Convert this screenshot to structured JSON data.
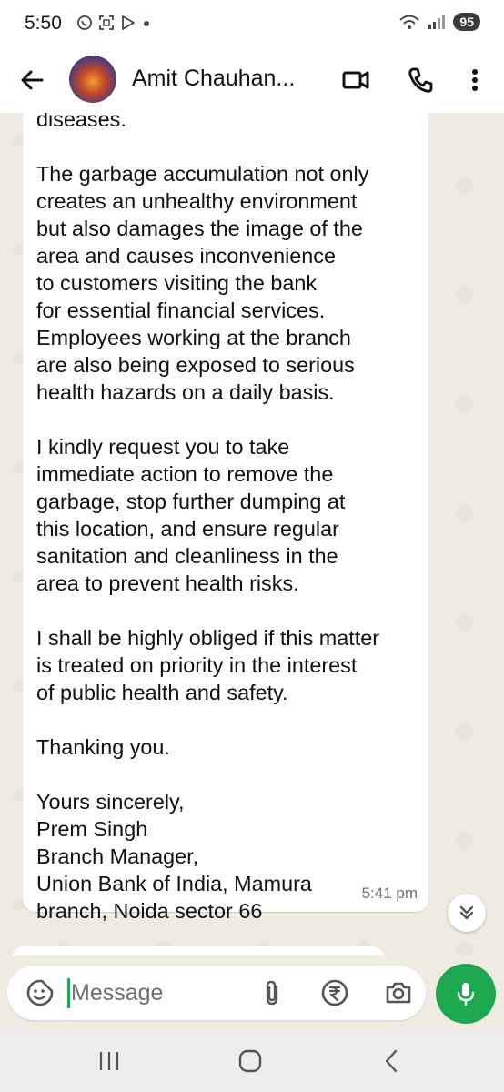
{
  "status_bar": {
    "time": "5:50",
    "battery": "95",
    "icons": [
      "whatsapp-icon",
      "screenshot-icon",
      "play-store-icon",
      "dot-icon",
      "wifi-icon",
      "signal-icon"
    ]
  },
  "header": {
    "contact_name": "Amit Chauhan...",
    "icons": [
      "back-arrow-icon",
      "video-call-icon",
      "voice-call-icon",
      "more-options-icon"
    ]
  },
  "message": {
    "lines_partial_top": "diseases.",
    "paragraphs": [
      [
        "The garbage accumulation not only",
        "creates an unhealthy environment",
        "but also damages the image of the",
        "area and causes inconvenience",
        "to customers visiting the bank",
        "for essential financial services.",
        "Employees working at the branch",
        "are also being exposed to serious",
        "health hazards on a daily basis."
      ],
      [
        "I kindly request you to take",
        "immediate action to remove the",
        "garbage, stop further dumping at",
        "this location, and ensure regular",
        "sanitation and cleanliness in the",
        "area to prevent health risks."
      ],
      [
        "I shall be highly obliged if this matter",
        "is treated on priority in the interest",
        "of public health and safety."
      ],
      [
        "Thanking you."
      ],
      [
        "Yours sincerely,",
        "Prem Singh",
        "Branch Manager,",
        "Union Bank of India, Mamura",
        "branch, Noida sector 66"
      ]
    ],
    "time": "5:41 pm"
  },
  "input": {
    "placeholder": "Message",
    "value": ""
  },
  "nav": {
    "icons": [
      "recents-icon",
      "home-icon",
      "back-icon"
    ]
  },
  "colors": {
    "accent_green": "#1da851",
    "chat_bg": "#efeae2",
    "bubble_bg": "#ffffff"
  }
}
